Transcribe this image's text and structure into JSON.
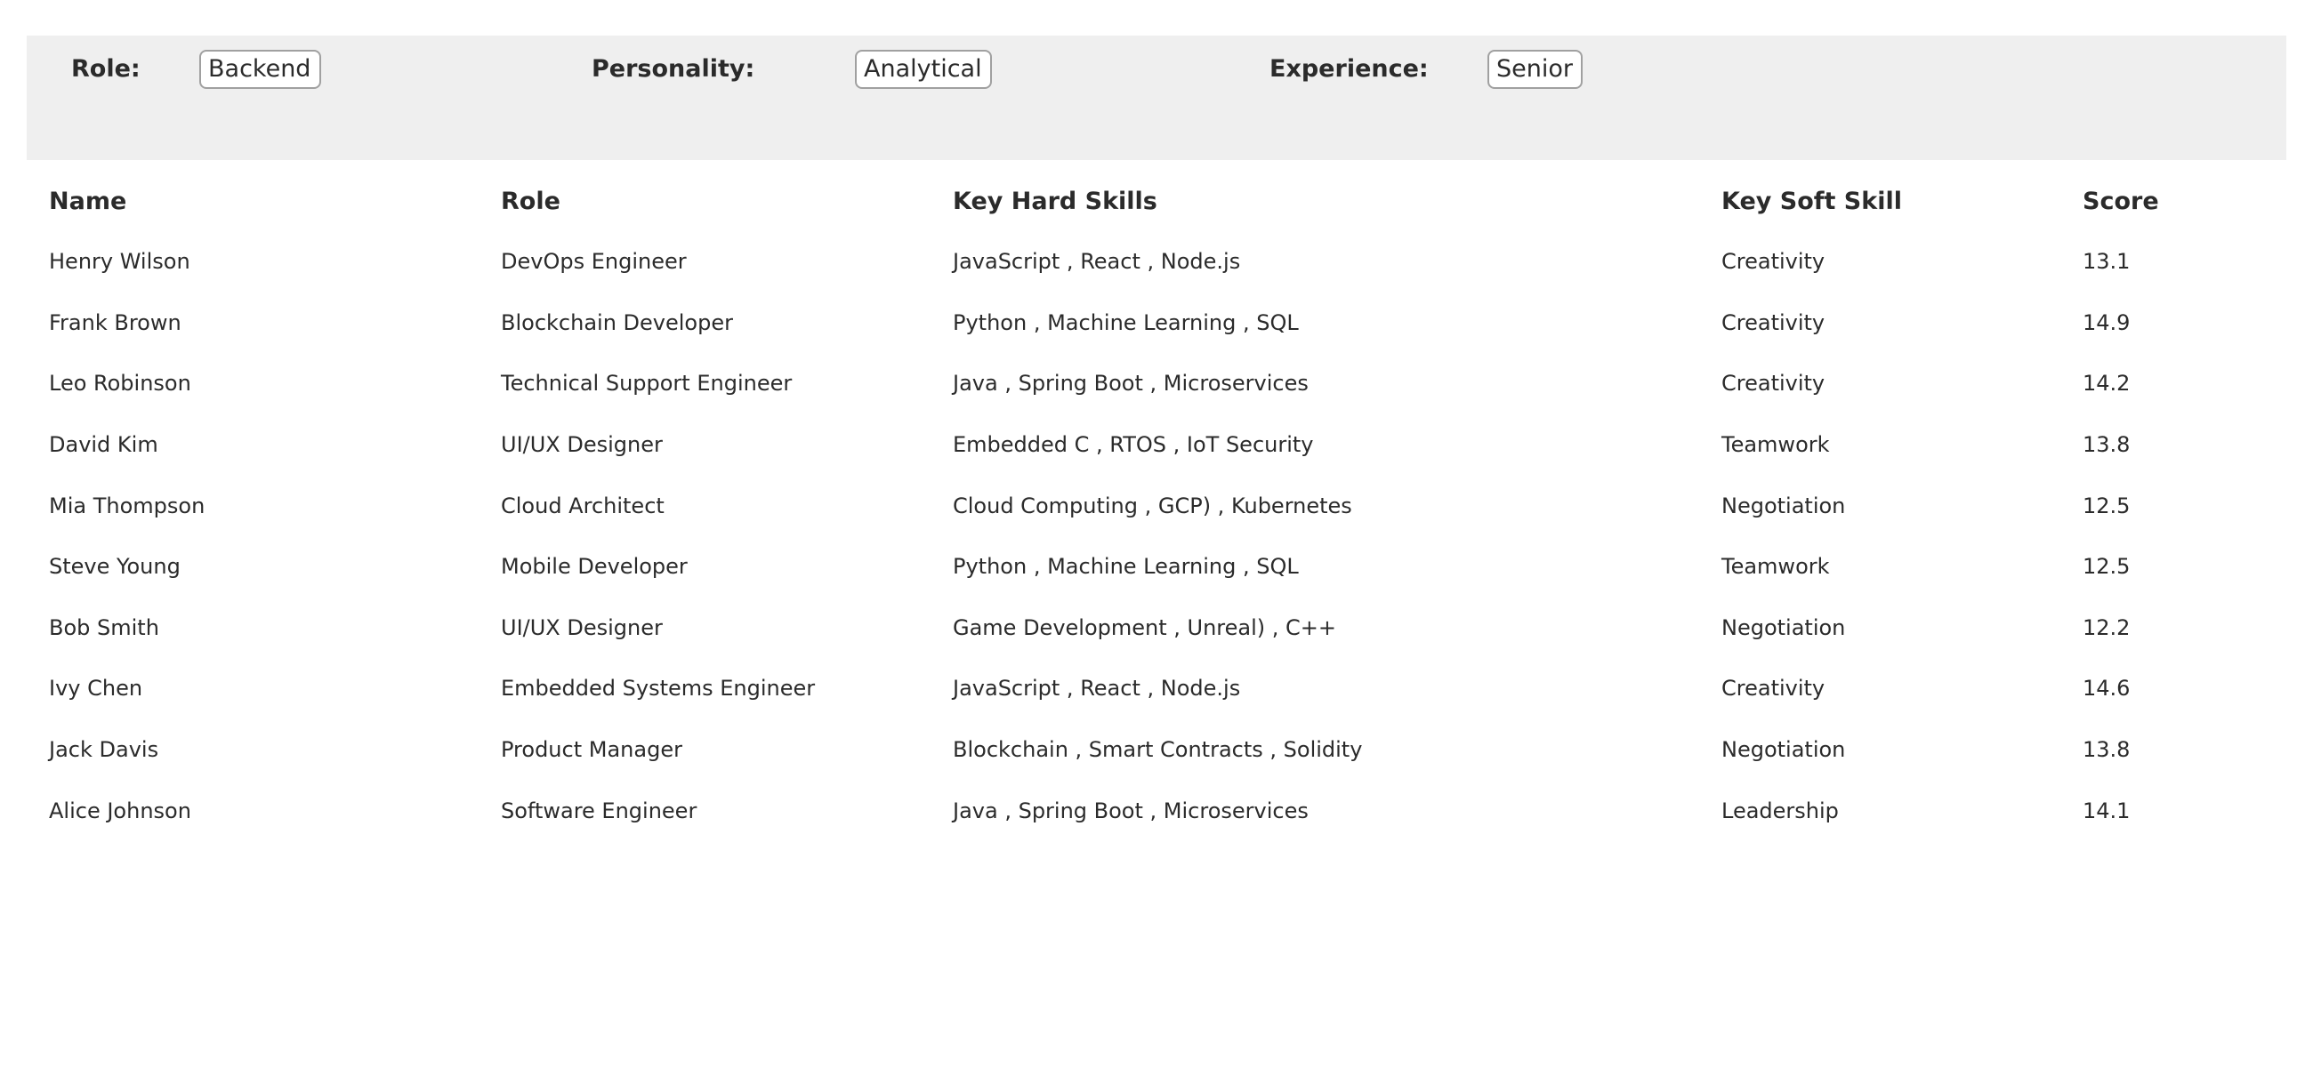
{
  "filters": {
    "role": {
      "label": "Role:",
      "value": "Backend"
    },
    "personality": {
      "label": "Personality:",
      "value": "Analytical"
    },
    "experience": {
      "label": "Experience:",
      "value": "Senior"
    }
  },
  "table": {
    "headers": [
      "Name",
      "Role",
      "Key Hard Skills",
      "Key Soft Skill",
      "Score"
    ],
    "rows": [
      [
        "Henry Wilson",
        "DevOps Engineer",
        "JavaScript , React , Node.js",
        "Creativity",
        "13.1"
      ],
      [
        "Frank Brown",
        "Blockchain Developer",
        "Python , Machine Learning , SQL",
        "Creativity",
        "14.9"
      ],
      [
        "Leo Robinson",
        "Technical Support Engineer",
        "Java , Spring Boot , Microservices",
        "Creativity",
        "14.2"
      ],
      [
        "David Kim",
        "UI/UX Designer",
        "Embedded C , RTOS , IoT Security",
        "Teamwork",
        "13.8"
      ],
      [
        "Mia Thompson",
        "Cloud Architect",
        "Cloud Computing , GCP) , Kubernetes",
        "Negotiation",
        "12.5"
      ],
      [
        "Steve Young",
        "Mobile Developer",
        "Python , Machine Learning , SQL",
        "Teamwork",
        "12.5"
      ],
      [
        "Bob Smith",
        "UI/UX Designer",
        "Game Development , Unreal) , C++",
        "Negotiation",
        "12.2"
      ],
      [
        "Ivy Chen",
        "Embedded Systems Engineer",
        "JavaScript , React , Node.js",
        "Creativity",
        "14.6"
      ],
      [
        "Jack Davis",
        "Product Manager",
        "Blockchain , Smart Contracts , Solidity",
        "Negotiation",
        "13.8"
      ],
      [
        "Alice Johnson",
        "Software Engineer",
        "Java , Spring Boot , Microservices",
        "Leadership",
        "14.1"
      ]
    ]
  }
}
